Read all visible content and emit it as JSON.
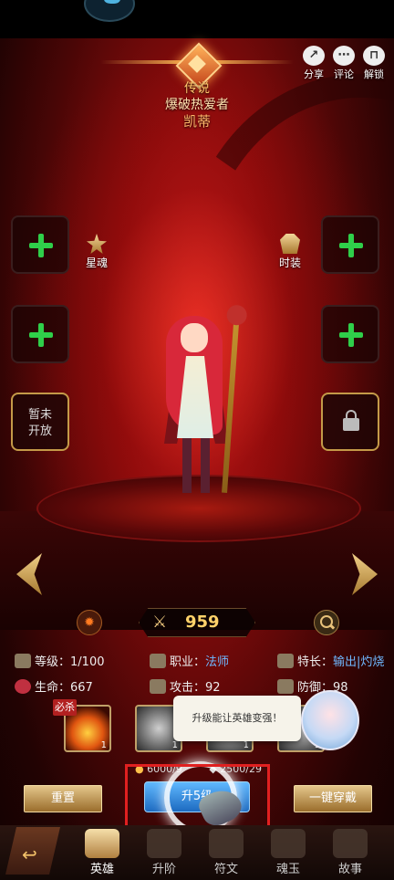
{
  "header": {
    "rarity": "传说",
    "subtitle": "爆破热爱者",
    "hero_name": "凯蒂"
  },
  "top_actions": [
    {
      "label": "分享",
      "icon": "share-icon"
    },
    {
      "label": "评论",
      "icon": "comment-icon"
    },
    {
      "label": "解锁",
      "icon": "unlock-icon"
    }
  ],
  "slots": {
    "locked_label": "暂未\n开放",
    "star_soul_label": "星魂",
    "costume_label": "时装"
  },
  "power": {
    "value": "959"
  },
  "stats": {
    "level_label": "等级：",
    "level_value": "1/100",
    "class_label": "职业：",
    "class_value": "法师",
    "specialty_label": "特长：",
    "specialty_value": "输出|灼烧",
    "hp_label": "生命：",
    "hp_value": "667",
    "atk_label": "攻击：",
    "atk_value": "92",
    "def_label": "防御：",
    "def_value": "98"
  },
  "skills": {
    "kill_tag": "必杀",
    "counts": [
      "1",
      "1",
      "1",
      "1"
    ]
  },
  "tooltip": "升级能让英雄变强！",
  "upgrade": {
    "cost_gold": "6000/9",
    "cost_exp": "2500/29",
    "button_label": "升5级"
  },
  "buttons": {
    "reset": "重置",
    "equip_all": "一键穿戴"
  },
  "tabs": [
    {
      "label": "英雄",
      "active": true
    },
    {
      "label": "升阶",
      "active": false
    },
    {
      "label": "符文",
      "active": false
    },
    {
      "label": "魂玉",
      "active": false
    },
    {
      "label": "故事",
      "active": false
    }
  ],
  "colors": {
    "accent_gold": "#ffc46a",
    "plus_green": "#2fcf4a",
    "highlight_red": "#e02020",
    "stat_blue": "#6fb8ff"
  }
}
